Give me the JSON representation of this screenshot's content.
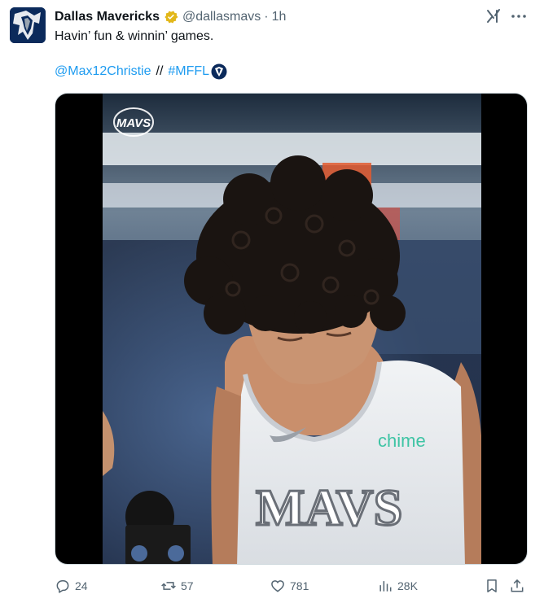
{
  "tweet": {
    "author_name": "Dallas Mavericks",
    "handle": "@dallasmavs",
    "separator": "·",
    "time": "1h",
    "text": "Havin’ fun & winnin’ games.",
    "mention": "@Max12Christie",
    "slashes": "//",
    "hashtag": "#MFFL"
  },
  "media": {
    "watermark_text": "MAVS",
    "jersey_text": "MAVS",
    "sponsor_text": "chime"
  },
  "actions": {
    "replies": "24",
    "reposts": "57",
    "likes": "781",
    "views": "28K"
  },
  "colors": {
    "link": "#1d9bf0",
    "muted": "#536471",
    "verified": "#e2b719",
    "team_blue": "#0b2a5b"
  }
}
